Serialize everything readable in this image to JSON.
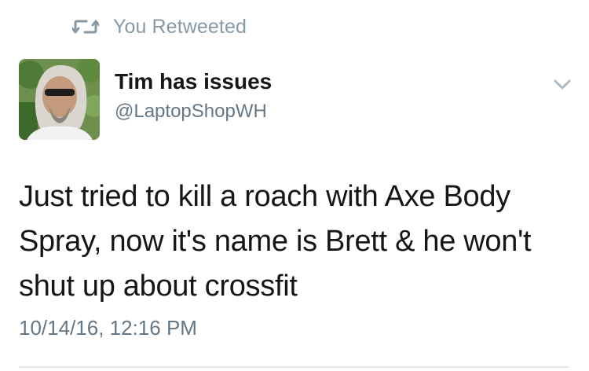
{
  "retweet_banner": {
    "label": "You Retweeted",
    "icon": "retweet-icon",
    "color": "#8899a6"
  },
  "author": {
    "display_name": "Tim has issues",
    "handle": "@LaptopShopWH",
    "avatar": "profile-photo"
  },
  "menu": {
    "icon": "chevron-down-icon"
  },
  "tweet": {
    "text": "Just tried to kill a roach with Axe Body Spray, now it's name is Brett & he won't shut up about crossfit",
    "timestamp": "10/14/16, 12:16 PM"
  },
  "colors": {
    "primary_text": "#14171a",
    "secondary_text": "#657786",
    "divider": "#e1e8ed"
  }
}
